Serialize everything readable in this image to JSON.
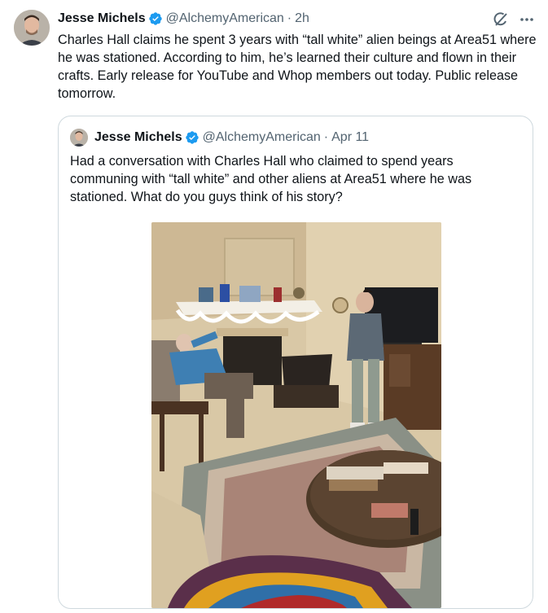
{
  "tweet": {
    "author_name": "Jesse Michels",
    "handle": "@AlchemyAmerican",
    "separator": "·",
    "time": "2h",
    "text": "Charles Hall claims he spent 3 years with “tall white” alien beings at Area51 where he was stationed. According to him, he’s learned their culture and flown in their crafts. Early release for YouTube and Whop members out today. Public release tomorrow."
  },
  "quoted_tweet": {
    "author_name": "Jesse Michels",
    "handle": "@AlchemyAmerican",
    "separator": "·",
    "time": "Apr 11",
    "text": "Had a conversation with Charles Hall who claimed to spend years communing with “tall white” and other aliens at Area51 where he was stationed. What do you guys think of his story?"
  },
  "icons": [
    "verified-badge-icon",
    "grok-icon",
    "more-icon"
  ],
  "colors": {
    "text": "#0f1419",
    "secondary": "#536471",
    "verified": "#1d9bf0",
    "border": "#cfd9de"
  }
}
